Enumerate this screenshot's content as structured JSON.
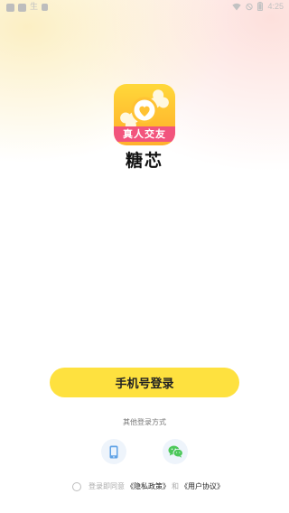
{
  "status_bar": {
    "left_text": "生",
    "time": "4:25"
  },
  "app": {
    "logo_ribbon": "真人交友",
    "name": "糖芯"
  },
  "login": {
    "phone_button": "手机号登录",
    "other_methods": "其他登录方式"
  },
  "agreement": {
    "prefix": "登录即同意",
    "privacy": "《隐私政策》",
    "and": "和",
    "terms": "《用户协议》"
  },
  "colors": {
    "primary_button": "#fee13f",
    "logo_yellow": "#ffc933",
    "logo_ribbon": "#f2547d",
    "wechat_green": "#4dc85a",
    "phone_icon_blue": "#5fa2e6"
  }
}
